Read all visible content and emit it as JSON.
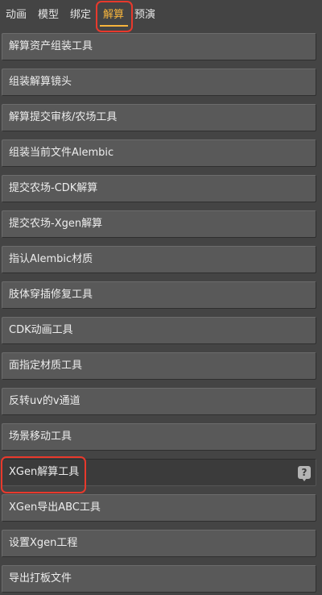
{
  "tabs": [
    {
      "label": "动画",
      "active": false
    },
    {
      "label": "模型",
      "active": false
    },
    {
      "label": "绑定",
      "active": false
    },
    {
      "label": "解算",
      "active": true
    },
    {
      "label": "预演",
      "active": false
    }
  ],
  "tools": [
    {
      "label": "解算资产组装工具"
    },
    {
      "label": "组装解算镜头"
    },
    {
      "label": "解算提交审核/农场工具"
    },
    {
      "label": "组装当前文件Alembic"
    },
    {
      "label": "提交农场-CDK解算"
    },
    {
      "label": "提交农场-Xgen解算"
    },
    {
      "label": "指认Alembic材质"
    },
    {
      "label": "肢体穿插修复工具"
    },
    {
      "label": "CDK动画工具"
    },
    {
      "label": "面指定材质工具"
    },
    {
      "label": "反转uv的v通道"
    },
    {
      "label": "场景移动工具"
    },
    {
      "label": "XGen解算工具",
      "selected": true,
      "help_icon": "?"
    },
    {
      "label": "XGen导出ABC工具"
    },
    {
      "label": "设置Xgen工程"
    },
    {
      "label": "导出打板文件"
    }
  ],
  "colors": {
    "accent": "#f6b43c",
    "highlight": "#e8392c",
    "panel_bg": "#444444",
    "button_bg": "#595959",
    "selected_bg": "#3b3b3b"
  }
}
